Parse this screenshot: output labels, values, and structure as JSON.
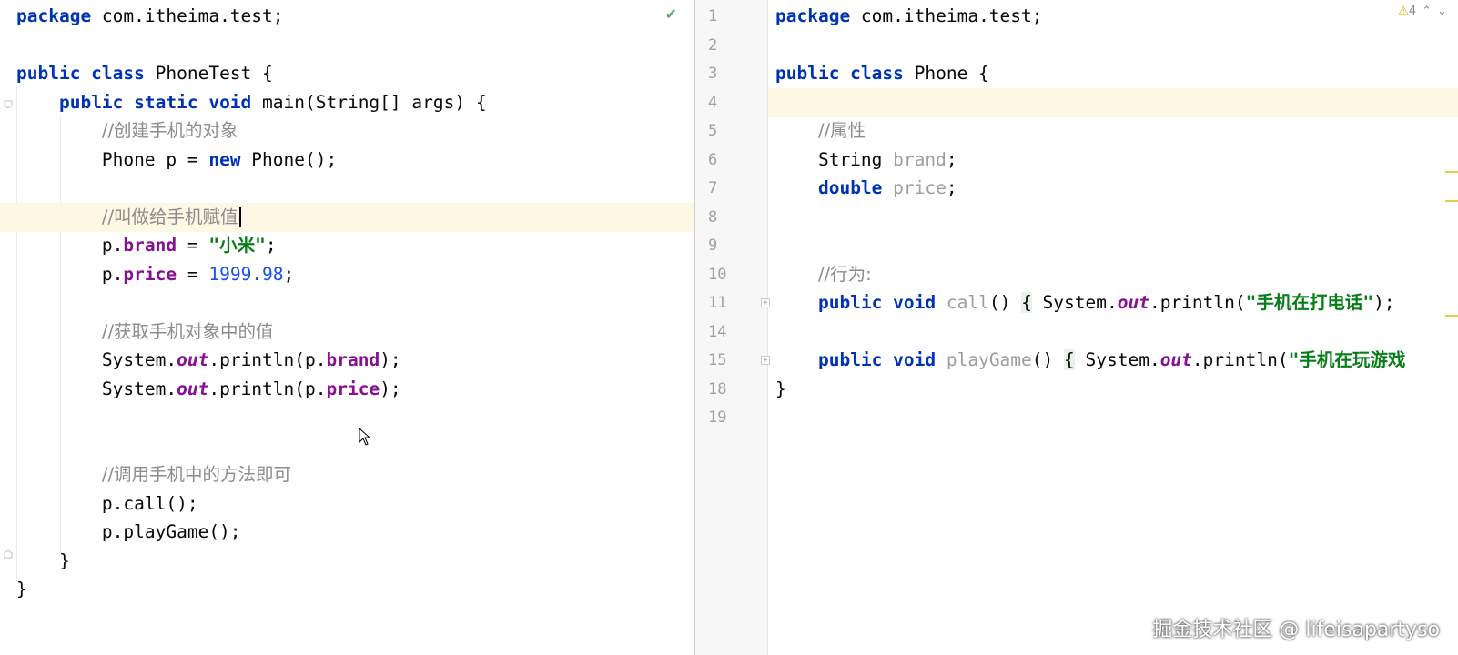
{
  "left_editor": {
    "lines": [
      [
        {
          "t": "package",
          "c": "kw"
        },
        {
          "t": " com.itheima.test;"
        }
      ],
      [],
      [
        {
          "t": "public class",
          "c": "kw"
        },
        {
          "t": " PhoneTest {"
        }
      ],
      [
        {
          "t": "    "
        },
        {
          "t": "public static void",
          "c": "kw"
        },
        {
          "t": " main(String[] args) {"
        }
      ],
      [
        {
          "t": "        "
        },
        {
          "t": "//创建手机的对象",
          "c": "cm"
        }
      ],
      [
        {
          "t": "        Phone p = "
        },
        {
          "t": "new",
          "c": "kw"
        },
        {
          "t": " Phone();"
        }
      ],
      [],
      [
        {
          "t": "        "
        },
        {
          "t": "//叫做给手机赋值",
          "c": "cm"
        }
      ],
      [
        {
          "t": "        p."
        },
        {
          "t": "brand",
          "c": "fld"
        },
        {
          "t": " = "
        },
        {
          "t": "\"小米\"",
          "c": "str"
        },
        {
          "t": ";"
        }
      ],
      [
        {
          "t": "        p."
        },
        {
          "t": "price",
          "c": "fld"
        },
        {
          "t": " = "
        },
        {
          "t": "1999.98",
          "c": "num"
        },
        {
          "t": ";"
        }
      ],
      [],
      [
        {
          "t": "        "
        },
        {
          "t": "//获取手机对象中的值",
          "c": "cm"
        }
      ],
      [
        {
          "t": "        System."
        },
        {
          "t": "out",
          "c": "st"
        },
        {
          "t": ".println(p."
        },
        {
          "t": "brand",
          "c": "fld"
        },
        {
          "t": ");"
        }
      ],
      [
        {
          "t": "        System."
        },
        {
          "t": "out",
          "c": "st"
        },
        {
          "t": ".println(p."
        },
        {
          "t": "price",
          "c": "fld"
        },
        {
          "t": ");"
        }
      ],
      [],
      [],
      [
        {
          "t": "        "
        },
        {
          "t": "//调用手机中的方法即可",
          "c": "cm"
        }
      ],
      [
        {
          "t": "        p.call();"
        }
      ],
      [
        {
          "t": "        p.playGame();"
        }
      ],
      [
        {
          "t": "    }"
        }
      ],
      [
        {
          "t": "}"
        }
      ]
    ]
  },
  "right_editor": {
    "line_numbers": [
      "1",
      "2",
      "3",
      "4",
      "5",
      "6",
      "7",
      "8",
      "9",
      "10",
      "11",
      "14",
      "15",
      "18",
      "19"
    ],
    "lines": [
      [
        {
          "t": "package",
          "c": "kw"
        },
        {
          "t": " com.itheima.test;"
        }
      ],
      [],
      [
        {
          "t": "public class",
          "c": "kw"
        },
        {
          "t": " Phone {"
        }
      ],
      [],
      [
        {
          "t": "    "
        },
        {
          "t": "//属性",
          "c": "cm"
        }
      ],
      [
        {
          "t": "    String "
        },
        {
          "t": "brand",
          "c": "unused"
        },
        {
          "t": ";"
        }
      ],
      [
        {
          "t": "    "
        },
        {
          "t": "double",
          "c": "kw"
        },
        {
          "t": " "
        },
        {
          "t": "price",
          "c": "unused"
        },
        {
          "t": ";"
        }
      ],
      [],
      [],
      [
        {
          "t": "    "
        },
        {
          "t": "//行为:",
          "c": "cm"
        }
      ],
      [
        {
          "t": "    "
        },
        {
          "t": "public void",
          "c": "kw"
        },
        {
          "t": " "
        },
        {
          "t": "call",
          "c": "unused"
        },
        {
          "t": "() "
        },
        {
          "t": "{",
          "c": "brace-hl"
        },
        {
          "t": " System."
        },
        {
          "t": "out",
          "c": "st"
        },
        {
          "t": ".println("
        },
        {
          "t": "\"手机在打电话\"",
          "c": "str"
        },
        {
          "t": ");"
        }
      ],
      [],
      [
        {
          "t": "    "
        },
        {
          "t": "public void",
          "c": "kw"
        },
        {
          "t": " "
        },
        {
          "t": "playGame",
          "c": "unused"
        },
        {
          "t": "() "
        },
        {
          "t": "{",
          "c": "brace-hl"
        },
        {
          "t": " System."
        },
        {
          "t": "out",
          "c": "st"
        },
        {
          "t": ".println("
        },
        {
          "t": "\"手机在玩游戏",
          "c": "str"
        }
      ],
      [
        {
          "t": "}"
        }
      ],
      []
    ],
    "warning_count": "4"
  },
  "icons": {
    "status_ok": "check-icon",
    "warning": "warning-triangle-icon",
    "nav_up": "chevron-up-icon",
    "nav_down": "chevron-down-icon",
    "pointer": "mouse-pointer-icon"
  },
  "watermark": "掘金技术社区 @ lifeisapartyso"
}
